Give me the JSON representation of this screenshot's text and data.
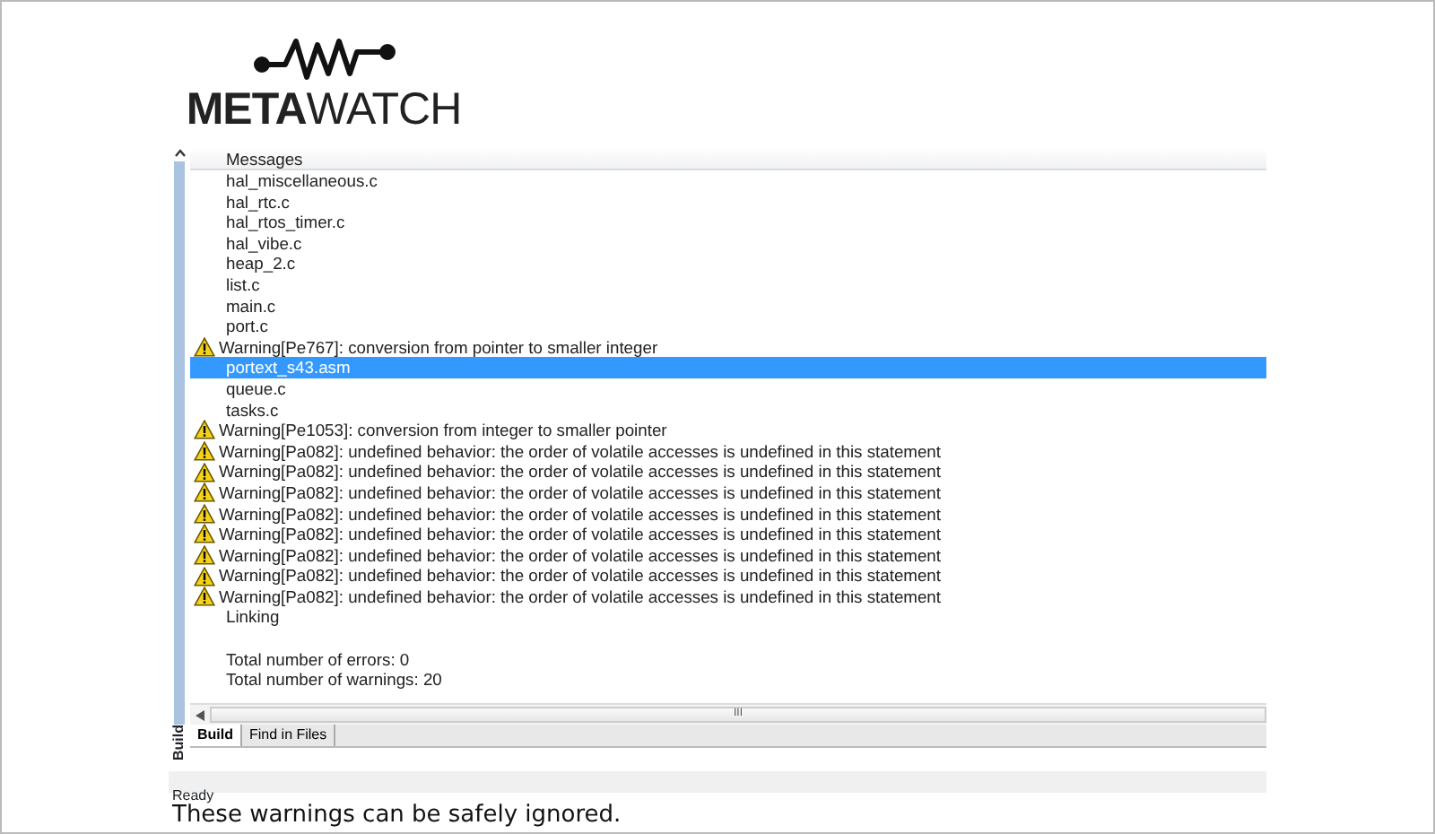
{
  "logo": {
    "text": "**META**WATCH"
  },
  "panel": {
    "side_label": "Build",
    "header": "Messages",
    "messages": [
      {
        "kind": "file",
        "text": "hal_miscellaneous.c",
        "selected": false
      },
      {
        "kind": "file",
        "text": "hal_rtc.c",
        "selected": false
      },
      {
        "kind": "file",
        "text": "hal_rtos_timer.c",
        "selected": false
      },
      {
        "kind": "file",
        "text": "hal_vibe.c",
        "selected": false
      },
      {
        "kind": "file",
        "text": "heap_2.c",
        "selected": false
      },
      {
        "kind": "file",
        "text": "list.c",
        "selected": false
      },
      {
        "kind": "file",
        "text": "main.c",
        "selected": false
      },
      {
        "kind": "file",
        "text": "port.c",
        "selected": false
      },
      {
        "kind": "warning",
        "text": "Warning[Pe767]: conversion from pointer to smaller integer",
        "selected": false
      },
      {
        "kind": "file",
        "text": "portext_s43.asm",
        "selected": true
      },
      {
        "kind": "file",
        "text": "queue.c",
        "selected": false
      },
      {
        "kind": "file",
        "text": "tasks.c",
        "selected": false
      },
      {
        "kind": "warning",
        "text": "Warning[Pe1053]: conversion from integer to smaller pointer",
        "selected": false
      },
      {
        "kind": "warning",
        "text": "Warning[Pa082]: undefined behavior: the order of volatile accesses is undefined in this statement",
        "selected": false
      },
      {
        "kind": "warning",
        "text": "Warning[Pa082]: undefined behavior: the order of volatile accesses is undefined in this statement",
        "selected": false
      },
      {
        "kind": "warning",
        "text": "Warning[Pa082]: undefined behavior: the order of volatile accesses is undefined in this statement",
        "selected": false
      },
      {
        "kind": "warning",
        "text": "Warning[Pa082]: undefined behavior: the order of volatile accesses is undefined in this statement",
        "selected": false
      },
      {
        "kind": "warning",
        "text": "Warning[Pa082]: undefined behavior: the order of volatile accesses is undefined in this statement",
        "selected": false
      },
      {
        "kind": "warning",
        "text": "Warning[Pa082]: undefined behavior: the order of volatile accesses is undefined in this statement",
        "selected": false
      },
      {
        "kind": "warning",
        "text": "Warning[Pa082]: undefined behavior: the order of volatile accesses is undefined in this statement",
        "selected": false
      },
      {
        "kind": "warning",
        "text": "Warning[Pa082]: undefined behavior: the order of volatile accesses is undefined in this statement",
        "selected": false
      },
      {
        "kind": "file",
        "text": "Linking",
        "selected": false
      },
      {
        "kind": "summary",
        "text": "Total number of errors: 0",
        "selected": false
      },
      {
        "kind": "file",
        "text": "Total number of warnings: 20",
        "selected": false
      }
    ],
    "scrollbar_grip": "III",
    "tabs": [
      {
        "label": "Build",
        "selected": true
      },
      {
        "label": "Find in Files",
        "selected": false
      }
    ],
    "status": "Ready"
  },
  "caption": "These warnings can be safely ignored."
}
